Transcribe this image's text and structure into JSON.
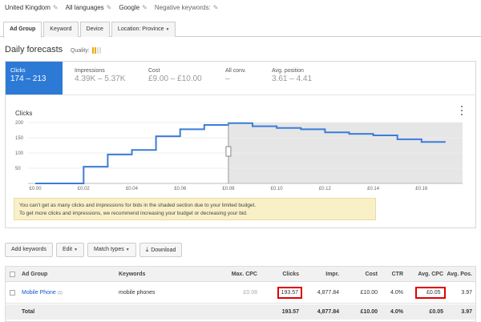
{
  "targeting": {
    "location": "United Kingdom",
    "language": "All languages",
    "network": "Google",
    "negative_keywords": "Negative keywords:"
  },
  "tabs": [
    {
      "label": "Ad Group",
      "active": true
    },
    {
      "label": "Keyword"
    },
    {
      "label": "Device"
    },
    {
      "label": "Location: Province"
    }
  ],
  "forecast": {
    "title": "Daily forecasts",
    "quality_label": "Quality:",
    "quality_level": 0.4,
    "metrics": [
      {
        "label": "Clicks",
        "value": "174 – 213",
        "active": true
      },
      {
        "label": "Impressions",
        "value": "4.39K – 5.37K"
      },
      {
        "label": "Cost",
        "value": "£9.00 – £10.00"
      },
      {
        "label": "All conv.",
        "value": "–"
      },
      {
        "label": "Avg. position",
        "value": "3.61 – 4.41"
      }
    ],
    "notice_line1": "You can't get as many clicks and impressions for bids in the shaded section due to your limited budget.",
    "notice_line2": "To get more clicks and impressions, we recommend increasing your budget or decreasing your bid."
  },
  "chart_data": {
    "type": "line",
    "title": "Clicks",
    "xlabel": "",
    "ylabel": "",
    "x_ticks": [
      "£0.00",
      "£0.02",
      "£0.04",
      "£0.06",
      "£0.08",
      "£0.10",
      "£0.12",
      "£0.14",
      "£0.16"
    ],
    "y_ticks": [
      50,
      100,
      150,
      200
    ],
    "xlim": [
      -0.003,
      0.177
    ],
    "ylim": [
      0,
      200
    ],
    "step": true,
    "shaded_from_x": 0.08,
    "marker_x": 0.08,
    "series": [
      {
        "color": "#3b7dd8",
        "x": [
          0.0,
          0.02,
          0.02,
          0.03,
          0.03,
          0.04,
          0.04,
          0.05,
          0.05,
          0.06,
          0.06,
          0.07,
          0.07,
          0.08,
          0.08,
          0.09,
          0.09,
          0.1,
          0.1,
          0.11,
          0.11,
          0.12,
          0.12,
          0.13,
          0.13,
          0.14,
          0.14,
          0.15,
          0.15,
          0.16,
          0.16,
          0.17
        ],
        "y": [
          0,
          0,
          55,
          55,
          95,
          95,
          110,
          110,
          155,
          155,
          178,
          178,
          192,
          192,
          198,
          198,
          188,
          188,
          182,
          182,
          178,
          178,
          168,
          168,
          163,
          163,
          158,
          158,
          145,
          145,
          136,
          136
        ]
      }
    ]
  },
  "toolbar": {
    "add_keywords": "Add keywords",
    "edit": "Edit",
    "match_types": "Match types",
    "download": "Download"
  },
  "table": {
    "headers": {
      "ad_group": "Ad Group",
      "keywords": "Keywords",
      "max_cpc": "Max. CPC",
      "clicks": "Clicks",
      "impr": "Impr.",
      "cost": "Cost",
      "ctr": "CTR",
      "avg_cpc": "Avg. CPC",
      "avg_pos": "Avg. Pos."
    },
    "rows": [
      {
        "ad_group": "Mobile Phone",
        "count": "(1)",
        "keywords": "mobile phones",
        "max_cpc": "£0.08",
        "clicks": "193.57",
        "impr": "4,877.84",
        "cost": "£10.00",
        "ctr": "4.0%",
        "avg_cpc": "£0.05",
        "avg_pos": "3.97"
      }
    ],
    "total": {
      "label": "Total",
      "clicks": "193.57",
      "impr": "4,877.84",
      "cost": "£10.00",
      "ctr": "4.0%",
      "avg_cpc": "£0.05",
      "avg_pos": "3.97"
    }
  },
  "colors": {
    "accent": "#2d7ad6",
    "line": "#3b7dd8",
    "highlight": "#e00000",
    "notice_bg": "#f9f0c8"
  }
}
